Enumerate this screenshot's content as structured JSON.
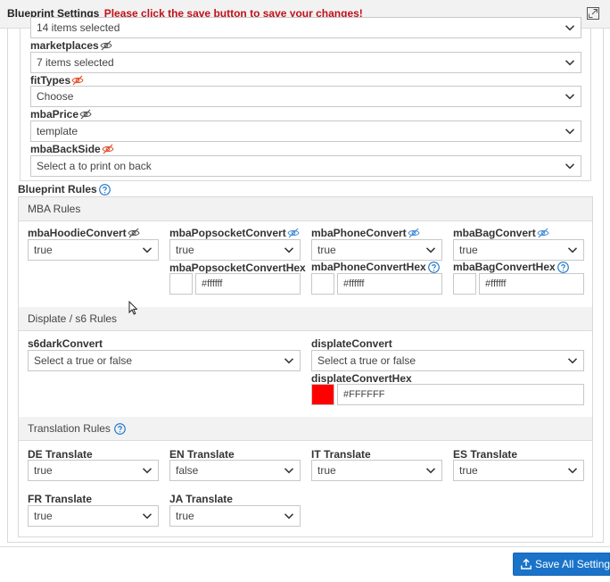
{
  "header": {
    "title": "Blueprint Settings",
    "warning": "Please click the save button to save your changes!",
    "expand_icon": "expand-icon"
  },
  "top_fields": [
    {
      "value": "14 items selected"
    },
    {
      "label": "marketplaces",
      "value": "7 items selected"
    },
    {
      "label": "fitTypes",
      "value": "Choose"
    },
    {
      "label": "mbaPrice",
      "value": "template"
    },
    {
      "label": "mbaBackSide",
      "value": "Select a to print on back"
    }
  ],
  "rules_heading": "Blueprint Rules",
  "mba": {
    "section": "MBA Rules",
    "hoodie": {
      "label": "mbaHoodieConvert",
      "value": "true"
    },
    "popsocket": {
      "label": "mbaPopsocketConvert",
      "value": "true",
      "hex_label": "mbaPopsocketConvertHex",
      "hex": "#ffffff"
    },
    "phone": {
      "label": "mbaPhoneConvert",
      "value": "true",
      "hex_label": "mbaPhoneConvertHex",
      "hex": "#ffffff"
    },
    "bag": {
      "label": "mbaBagConvert",
      "value": "true",
      "hex_label": "mbaBagConvertHex",
      "hex": "#ffffff"
    }
  },
  "displate": {
    "section": "Displate / s6 Rules",
    "s6dark": {
      "label": "s6darkConvert",
      "value": "Select a true or false"
    },
    "displate": {
      "label": "displateConvert",
      "value": "Select a true or false"
    },
    "hex": {
      "label": "displateConvertHex",
      "value": "#FFFFFF",
      "swatch_color": "#ff0000"
    }
  },
  "translation": {
    "section": "Translation Rules",
    "de": {
      "label": "DE Translate",
      "value": "true"
    },
    "en": {
      "label": "EN Translate",
      "value": "false"
    },
    "it": {
      "label": "IT Translate",
      "value": "true"
    },
    "es": {
      "label": "ES Translate",
      "value": "true"
    },
    "fr": {
      "label": "FR Translate",
      "value": "true"
    },
    "ja": {
      "label": "JA Translate",
      "value": "true"
    }
  },
  "footer": {
    "save_label": "Save All Settings"
  },
  "colors": {
    "accent": "#1a73c9",
    "warning": "#c0121a",
    "help": "#1a73c9",
    "eye_orange": "#e0502e",
    "eye_gray": "#555555",
    "eye_blue": "#4a8fd6"
  }
}
